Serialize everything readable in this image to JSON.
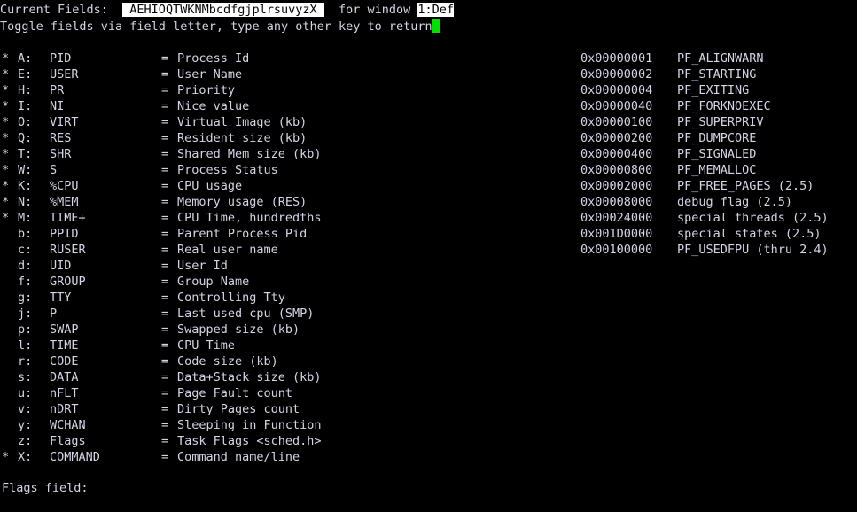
{
  "terminal": {
    "background_color": "#000000",
    "text_color": "#d4d4e4",
    "cursor_color": "#00e000",
    "inverse_bg_color": "#ffffff",
    "inverse_fg_color": "#000000"
  },
  "header": {
    "current_fields_label": "Current Fields:  ",
    "current_fields_value": " AEHIOQTWKNMbcdfgjplrsuvyzX ",
    "for_window_label": "  for window ",
    "window_value": "1:Def",
    "instructions": "Toggle fields via field letter, type any other key to return"
  },
  "fields": {
    "on_marker": "*",
    "off_marker": " ",
    "separator": "=",
    "items": [
      {
        "marker": "*",
        "key": "A:",
        "name": "PID",
        "desc": "Process Id"
      },
      {
        "marker": "*",
        "key": "E:",
        "name": "USER",
        "desc": "User Name"
      },
      {
        "marker": "*",
        "key": "H:",
        "name": "PR",
        "desc": "Priority"
      },
      {
        "marker": "*",
        "key": "I:",
        "name": "NI",
        "desc": "Nice value"
      },
      {
        "marker": "*",
        "key": "O:",
        "name": "VIRT",
        "desc": "Virtual Image (kb)"
      },
      {
        "marker": "*",
        "key": "Q:",
        "name": "RES",
        "desc": "Resident size (kb)"
      },
      {
        "marker": "*",
        "key": "T:",
        "name": "SHR",
        "desc": "Shared Mem size (kb)"
      },
      {
        "marker": "*",
        "key": "W:",
        "name": "S",
        "desc": "Process Status"
      },
      {
        "marker": "*",
        "key": "K:",
        "name": "%CPU",
        "desc": "CPU usage"
      },
      {
        "marker": "*",
        "key": "N:",
        "name": "%MEM",
        "desc": "Memory usage (RES)"
      },
      {
        "marker": "*",
        "key": "M:",
        "name": "TIME+",
        "desc": "CPU Time, hundredths"
      },
      {
        "marker": " ",
        "key": "b:",
        "name": "PPID",
        "desc": "Parent Process Pid"
      },
      {
        "marker": " ",
        "key": "c:",
        "name": "RUSER",
        "desc": "Real user name"
      },
      {
        "marker": " ",
        "key": "d:",
        "name": "UID",
        "desc": "User Id"
      },
      {
        "marker": " ",
        "key": "f:",
        "name": "GROUP",
        "desc": "Group Name"
      },
      {
        "marker": " ",
        "key": "g:",
        "name": "TTY",
        "desc": "Controlling Tty"
      },
      {
        "marker": " ",
        "key": "j:",
        "name": "P",
        "desc": "Last used cpu (SMP)"
      },
      {
        "marker": " ",
        "key": "p:",
        "name": "SWAP",
        "desc": "Swapped size (kb)"
      },
      {
        "marker": " ",
        "key": "l:",
        "name": "TIME",
        "desc": "CPU Time"
      },
      {
        "marker": " ",
        "key": "r:",
        "name": "CODE",
        "desc": "Code size (kb)"
      },
      {
        "marker": " ",
        "key": "s:",
        "name": "DATA",
        "desc": "Data+Stack size (kb)"
      },
      {
        "marker": " ",
        "key": "u:",
        "name": "nFLT",
        "desc": "Page Fault count"
      },
      {
        "marker": " ",
        "key": "v:",
        "name": "nDRT",
        "desc": "Dirty Pages count"
      },
      {
        "marker": " ",
        "key": "y:",
        "name": "WCHAN",
        "desc": "Sleeping in Function"
      },
      {
        "marker": " ",
        "key": "z:",
        "name": "Flags",
        "desc": "Task Flags <sched.h>"
      },
      {
        "marker": "*",
        "key": "X:",
        "name": "COMMAND",
        "desc": "Command name/line"
      }
    ]
  },
  "flags_legend": {
    "items": [
      {
        "hex": "0x00000001",
        "name": "PF_ALIGNWARN"
      },
      {
        "hex": "0x00000002",
        "name": "PF_STARTING"
      },
      {
        "hex": "0x00000004",
        "name": "PF_EXITING"
      },
      {
        "hex": "0x00000040",
        "name": "PF_FORKNOEXEC"
      },
      {
        "hex": "0x00000100",
        "name": "PF_SUPERPRIV"
      },
      {
        "hex": "0x00000200",
        "name": "PF_DUMPCORE"
      },
      {
        "hex": "0x00000400",
        "name": "PF_SIGNALED"
      },
      {
        "hex": "0x00000800",
        "name": "PF_MEMALLOC"
      },
      {
        "hex": "0x00002000",
        "name": "PF_FREE_PAGES (2.5)"
      },
      {
        "hex": "0x00008000",
        "name": "debug flag (2.5)"
      },
      {
        "hex": "0x00024000",
        "name": "special threads (2.5)"
      },
      {
        "hex": "0x001D0000",
        "name": "special states (2.5)"
      },
      {
        "hex": "0x00100000",
        "name": "PF_USEDFPU (thru 2.4)"
      }
    ]
  },
  "footer": {
    "prompt": "Flags field:"
  }
}
